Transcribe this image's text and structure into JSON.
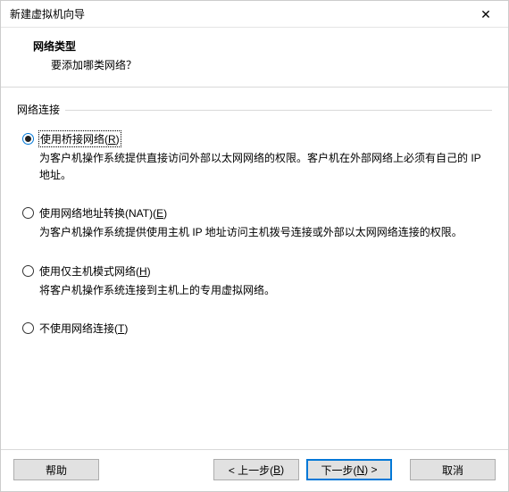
{
  "window": {
    "title": "新建虚拟机向导"
  },
  "header": {
    "title": "网络类型",
    "subtitle": "要添加哪类网络？"
  },
  "group": {
    "label": "网络连接"
  },
  "options": {
    "bridged": {
      "label_pre": "使用桥接网络(",
      "label_key": "R",
      "label_post": ")",
      "desc": "为客户机操作系统提供直接访问外部以太网网络的权限。客户机在外部网络上必须有自己的 IP 地址。",
      "selected": true
    },
    "nat": {
      "label_pre": "使用网络地址转换(NAT)(",
      "label_key": "E",
      "label_post": ")",
      "desc": "为客户机操作系统提供使用主机 IP 地址访问主机拨号连接或外部以太网网络连接的权限。",
      "selected": false
    },
    "hostonly": {
      "label_pre": "使用仅主机模式网络(",
      "label_key": "H",
      "label_post": ")",
      "desc": "将客户机操作系统连接到主机上的专用虚拟网络。",
      "selected": false
    },
    "none": {
      "label_pre": "不使用网络连接(",
      "label_key": "T",
      "label_post": ")",
      "desc": "",
      "selected": false
    }
  },
  "buttons": {
    "help": "帮助",
    "back_pre": "< 上一步(",
    "back_key": "B",
    "back_post": ")",
    "next_pre": "下一步(",
    "next_key": "N",
    "next_post": ") >",
    "cancel": "取消"
  }
}
